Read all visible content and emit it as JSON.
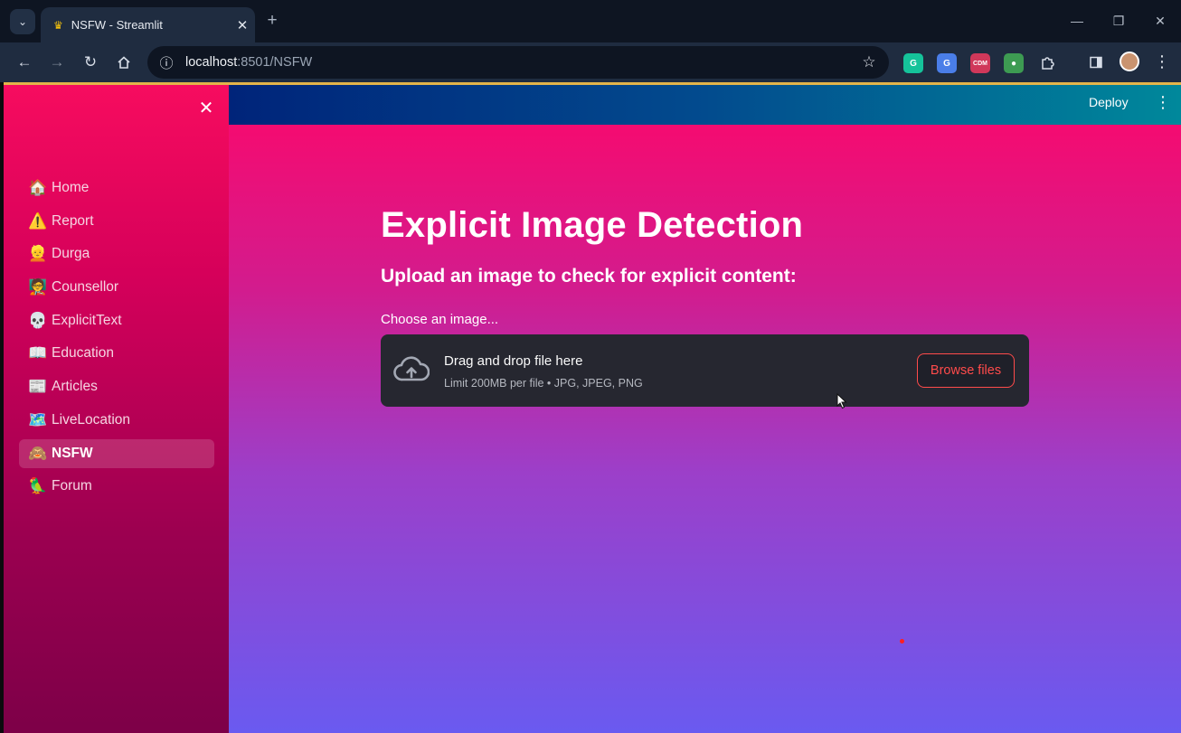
{
  "browser": {
    "tab_title": "NSFW - Streamlit",
    "tab_close": "✕",
    "url_host": "localhost",
    "url_path": ":8501/NSFW",
    "extensions": [
      {
        "name": "grammarly-icon",
        "label": "G",
        "color": "#15c39a"
      },
      {
        "name": "translate-icon",
        "label": "G",
        "color": "#4a7ee8"
      },
      {
        "name": "shield-extension-icon",
        "label": "CDM",
        "color": "#d0385a"
      },
      {
        "name": "color-picker-icon",
        "label": "●",
        "color": "#3d9b52"
      }
    ]
  },
  "sidebar": {
    "items": [
      {
        "emoji": "🏠",
        "label": "Home",
        "active": false
      },
      {
        "emoji": "⚠️",
        "label": "Report",
        "active": false
      },
      {
        "emoji": "👱",
        "label": "Durga",
        "active": false
      },
      {
        "emoji": "🧑‍🏫",
        "label": "Counsellor",
        "active": false
      },
      {
        "emoji": "💀",
        "label": "ExplicitText",
        "active": false
      },
      {
        "emoji": "📖",
        "label": "Education",
        "active": false
      },
      {
        "emoji": "📰",
        "label": "Articles",
        "active": false
      },
      {
        "emoji": "🗺️",
        "label": "LiveLocation",
        "active": false
      },
      {
        "emoji": "🙈",
        "label": "NSFW",
        "active": true
      },
      {
        "emoji": "🦜",
        "label": "Forum",
        "active": false
      }
    ]
  },
  "header": {
    "deploy_label": "Deploy"
  },
  "main": {
    "title": "Explicit Image Detection",
    "subtitle": "Upload an image to check for explicit content:",
    "uploader": {
      "label": "Choose an image...",
      "drop_title": "Drag and drop file here",
      "limit": "Limit 200MB per file • JPG, JPEG, PNG",
      "browse_label": "Browse files"
    }
  },
  "colors": {
    "sidebar_top": "#f70c5f",
    "header_left": "#00247a",
    "header_right": "#00889b",
    "accent_red": "#ff4b4b",
    "dropzone_bg": "#262730"
  }
}
